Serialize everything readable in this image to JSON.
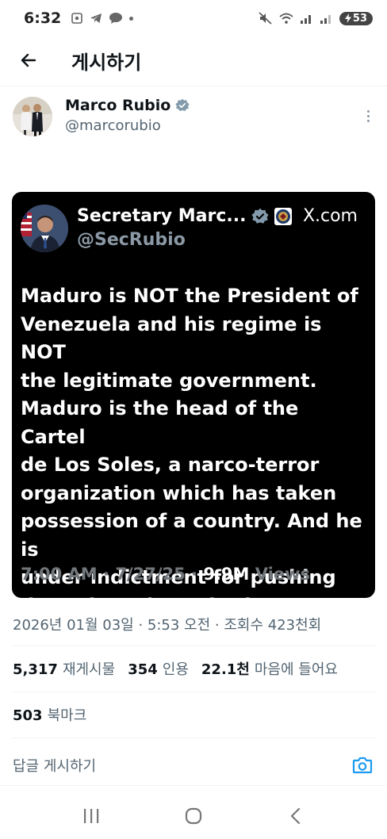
{
  "status_bar": {
    "time": "6:32",
    "battery": "53"
  },
  "header": {
    "title": "게시하기"
  },
  "author": {
    "name": "Marco Rubio",
    "handle": "@marcorubio"
  },
  "embedded_post": {
    "name": "Secretary Marc...",
    "handle": "@SecRubio",
    "site": "X.com",
    "text": "Maduro is NOT the President of\nVenezuela and his regime is NOT\nthe legitimate government.\nMaduro is the head of the Cartel\nde Los Soles, a narco-terror\norganization which has taken\npossession of a country.  And he is\nunder indictment for pushing\ndrugs into the United States.",
    "time": "7:00 AM",
    "date": "7/27/25",
    "views_count": "9.9M",
    "views_label": "Views",
    "separator": "·"
  },
  "post_meta": {
    "text": "2026년 01월 03일 · 5:53 오전 · 조회수 423천회"
  },
  "stats": {
    "reposts_count": "5,317",
    "reposts_label": "재게시물",
    "quotes_count": "354",
    "quotes_label": "인용",
    "likes_count": "22.1천",
    "likes_label": "마음에 들어요",
    "bookmarks_count": "503",
    "bookmarks_label": "북마크"
  },
  "reply": {
    "placeholder": "답글 게시하기"
  },
  "colors": {
    "accent": "#1d9bf0",
    "verified_blue": "#1d9bf0",
    "embed_bg": "#000000",
    "muted": "#536471"
  }
}
